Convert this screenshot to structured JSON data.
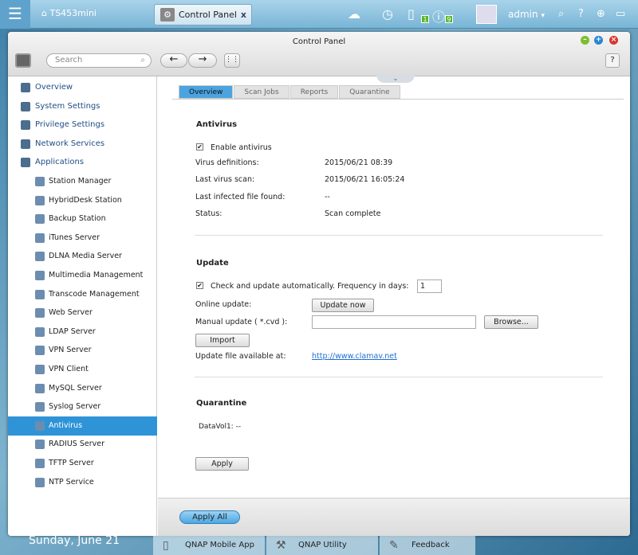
{
  "topbar": {
    "home_label": "TS453mini",
    "tab_label": "Control Panel",
    "tab_close": "x",
    "user": "admin",
    "user_caret": "▾",
    "badges": {
      "devices": "1",
      "notifications": "9"
    }
  },
  "window": {
    "title": "Control Panel",
    "search_placeholder": "Search",
    "help": "?"
  },
  "sidebar": {
    "top": [
      {
        "label": "Overview"
      },
      {
        "label": "System Settings"
      },
      {
        "label": "Privilege Settings"
      },
      {
        "label": "Network Services"
      },
      {
        "label": "Applications"
      }
    ],
    "apps": [
      {
        "label": "Station Manager"
      },
      {
        "label": "HybridDesk Station"
      },
      {
        "label": "Backup Station"
      },
      {
        "label": "iTunes Server"
      },
      {
        "label": "DLNA Media Server"
      },
      {
        "label": "Multimedia Management"
      },
      {
        "label": "Transcode Management"
      },
      {
        "label": "Web Server"
      },
      {
        "label": "LDAP Server"
      },
      {
        "label": "VPN Server"
      },
      {
        "label": "VPN Client"
      },
      {
        "label": "MySQL Server"
      },
      {
        "label": "Syslog Server"
      },
      {
        "label": "Antivirus",
        "selected": true
      },
      {
        "label": "RADIUS Server"
      },
      {
        "label": "TFTP Server"
      },
      {
        "label": "NTP Service"
      }
    ]
  },
  "tabs": [
    "Overview",
    "Scan Jobs",
    "Reports",
    "Quarantine"
  ],
  "antivirus": {
    "heading": "Antivirus",
    "enable_label": "Enable antivirus",
    "enabled": true,
    "rows": [
      {
        "label": "Virus definitions:",
        "value": "2015/06/21 08:39"
      },
      {
        "label": "Last virus scan:",
        "value": "2015/06/21 16:05:24"
      },
      {
        "label": "Last infected file found:",
        "value": "--"
      },
      {
        "label": "Status:",
        "value": "Scan complete"
      }
    ]
  },
  "update": {
    "heading": "Update",
    "auto_label": "Check and update automatically. Frequency in days:",
    "auto_checked": true,
    "frequency": "1",
    "online_label": "Online update:",
    "update_now": "Update now",
    "manual_label": "Manual update ( *.cvd ):",
    "manual_value": "",
    "browse": "Browse...",
    "import": "Import",
    "file_label": "Update file available at:",
    "file_link": "http://www.clamav.net"
  },
  "quarantine": {
    "heading": "Quarantine",
    "volume": "DataVol1: --"
  },
  "apply": "Apply",
  "apply_all": "Apply All",
  "desktop": {
    "date": "Sunday, June 21",
    "dock": [
      "QNAP Mobile App",
      "QNAP Utility",
      "Feedback"
    ]
  }
}
